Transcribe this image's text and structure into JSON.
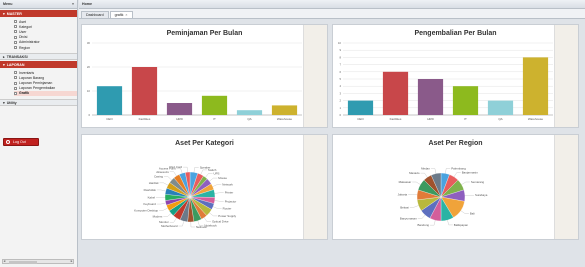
{
  "sidebar": {
    "title": "Menu",
    "collapse_glyph": "«",
    "master": {
      "label": "MASTER",
      "items": [
        "Aset",
        "Kategori",
        "User",
        "Divisi",
        "Administrator",
        "Region"
      ]
    },
    "transaksi": {
      "label": "TRANSAKSI"
    },
    "laporan": {
      "label": "LAPORAN",
      "items": [
        "Inventaris",
        "Laporan Barang",
        "Laporan Peminjaman",
        "Laporan Pengembalian",
        "Grafik"
      ],
      "active": "Grafik"
    },
    "utility": {
      "label": "Utility"
    },
    "logout": {
      "label": "Log Out"
    },
    "scroll": {
      "left": "◂",
      "right": "▸"
    }
  },
  "header": {
    "title": "Home"
  },
  "tabs": [
    {
      "label": "Dashboard",
      "active": false
    },
    {
      "label": "grafik",
      "active": true,
      "close": "×"
    }
  ],
  "palette": [
    "#2f9bb0",
    "#c8474a",
    "#8a5a8a",
    "#8dba1e",
    "#8fd0d8",
    "#cdb22e"
  ],
  "pie_palette": [
    "#4aa3df",
    "#e85d5d",
    "#7fb24c",
    "#8e5fbf",
    "#f0a33a",
    "#2bb3a4",
    "#d35e9b",
    "#5d6fbf",
    "#b8b83c",
    "#e07b39",
    "#3c9a5f",
    "#a0522d",
    "#6c7a89",
    "#c0392b",
    "#16a085",
    "#f39c12",
    "#8e44ad",
    "#27ae60",
    "#2980b9",
    "#d4a017",
    "#7f8c8d",
    "#e67e22"
  ],
  "chart_data": [
    {
      "type": "bar",
      "title": "Peminjaman Per Bulan",
      "categories": [
        "CEO",
        "Facilities",
        "HRD",
        "IT",
        "QA",
        "Warehouse"
      ],
      "values": [
        12,
        20,
        5,
        8,
        2,
        4
      ],
      "ylim": [
        0,
        30
      ],
      "yticks": [
        "0",
        "10",
        "20",
        "30"
      ],
      "xlabel": "",
      "ylabel": ""
    },
    {
      "type": "bar",
      "title": "Pengembalian Per Bulan",
      "categories": [
        "CEO",
        "Facilities",
        "HRD",
        "IT",
        "QA",
        "Warehouse"
      ],
      "values": [
        2,
        6,
        5,
        4,
        2,
        8
      ],
      "ylim": [
        0,
        10
      ],
      "yticks": [
        "0",
        "1",
        "2",
        "3",
        "4",
        "5",
        "6",
        "7",
        "8",
        "9",
        "10"
      ],
      "xlabel": "",
      "ylabel": ""
    },
    {
      "type": "pie",
      "title": "Aset Per Kategori",
      "labels": [
        "Speaker",
        "Switch",
        "UPS",
        "Mouse",
        "Network",
        "Printer",
        "Projector",
        "Router",
        "Power Supply",
        "Optical Drive",
        "Notebook",
        "Netbook",
        "Motherboard",
        "Monitor",
        "Modem",
        "Komputer Desktop",
        "Keyboard",
        "Kabel",
        "Flashdisk",
        "Hardisk",
        "Casing",
        "Aksesoris",
        "Access Point",
        "VGA Card"
      ],
      "values": [
        5,
        4,
        3,
        4,
        4,
        5,
        4,
        4,
        5,
        4,
        5,
        4,
        5,
        5,
        4,
        4,
        3,
        4,
        4,
        4,
        4,
        4,
        4,
        3
      ]
    },
    {
      "type": "pie",
      "title": "Aset Per Region",
      "labels": [
        "Palembang",
        "Banjarmasin",
        "Semarang",
        "Surabaya",
        "Bali",
        "Balikpapan",
        "Bandung",
        "Banyumasan",
        "Bekasi",
        "Jakarta",
        "Makassar",
        "Manado",
        "Medan"
      ],
      "values": [
        6,
        7,
        8,
        8,
        14,
        9,
        8,
        8,
        8,
        7,
        8,
        6,
        7
      ]
    }
  ]
}
